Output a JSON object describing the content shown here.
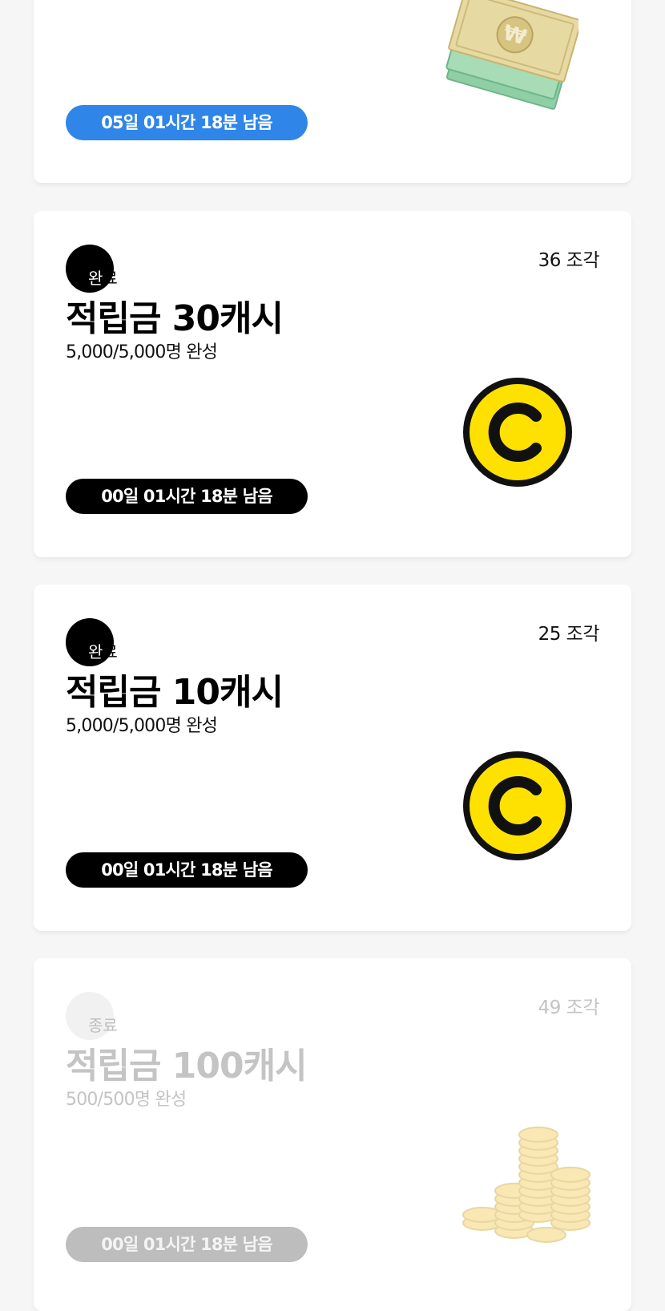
{
  "cards": [
    {
      "timer": "05일 01시간 18분 남음",
      "image": "won-banknotes-icon",
      "timer_color": "#2f86e8"
    },
    {
      "pieces": "36 조각",
      "status_first": "완",
      "status_rest": "료",
      "title": "적립금 30캐시",
      "subtitle": "5,000/5,000명 완성",
      "timer": "00일 01시간 18분 남음",
      "image": "cash-coin-icon",
      "timer_color": "#000000"
    },
    {
      "pieces": "25 조각",
      "status_first": "완",
      "status_rest": "료",
      "title": "적립금 10캐시",
      "subtitle": "5,000/5,000명 완성",
      "timer": "00일 01시간 18분 남음",
      "image": "cash-coin-icon",
      "timer_color": "#000000"
    },
    {
      "pieces": "49 조각",
      "status_first": "종",
      "status_rest": "료",
      "title": "적립금 100캐시",
      "subtitle": "500/500명 완성",
      "timer": "00일 01시간 18분 남음",
      "image": "gold-coins-stack-icon",
      "timer_color": "#bdbdbd"
    }
  ],
  "colors": {
    "coin_yellow": "#ffe100",
    "background": "#f6f6f6",
    "faded_text": "#c4c4c4"
  }
}
